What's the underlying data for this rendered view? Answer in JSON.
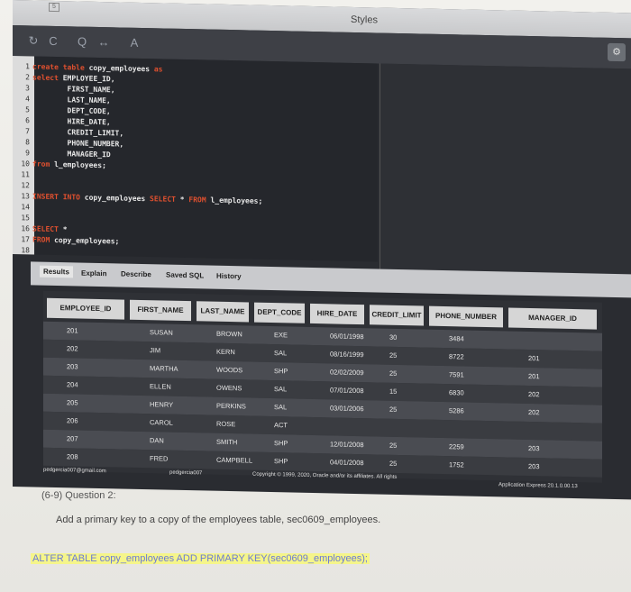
{
  "window": {
    "title": "Styles",
    "corner_glyph": "5"
  },
  "toolbar": {
    "icons": [
      "undo-icon",
      "redo-icon",
      "search-icon",
      "swap-icon",
      "text-icon"
    ],
    "glyphs": [
      "↻",
      "C",
      "Q",
      "↔",
      "A"
    ]
  },
  "editor": {
    "lines": [
      {
        "n": "1",
        "parts": [
          {
            "t": "create table",
            "k": true
          },
          {
            "t": " copy_employees ",
            "k": false
          },
          {
            "t": "as",
            "k": true
          }
        ]
      },
      {
        "n": "2",
        "parts": [
          {
            "t": "select",
            "k": true
          },
          {
            "t": " EMPLOYEE_ID,",
            "k": false
          }
        ]
      },
      {
        "n": "3",
        "parts": [
          {
            "t": "        FIRST_NAME,",
            "k": false
          }
        ]
      },
      {
        "n": "4",
        "parts": [
          {
            "t": "        LAST_NAME,",
            "k": false
          }
        ]
      },
      {
        "n": "5",
        "parts": [
          {
            "t": "        DEPT_CODE,",
            "k": false
          }
        ]
      },
      {
        "n": "6",
        "parts": [
          {
            "t": "        HIRE_DATE,",
            "k": false
          }
        ]
      },
      {
        "n": "7",
        "parts": [
          {
            "t": "        CREDIT_LIMIT,",
            "k": false
          }
        ]
      },
      {
        "n": "8",
        "parts": [
          {
            "t": "        PHONE_NUMBER,",
            "k": false
          }
        ]
      },
      {
        "n": "9",
        "parts": [
          {
            "t": "        MANAGER_ID",
            "k": false
          }
        ]
      },
      {
        "n": "10",
        "parts": [
          {
            "t": "from",
            "k": true
          },
          {
            "t": " l_employees;",
            "k": false
          }
        ]
      },
      {
        "n": "11",
        "parts": []
      },
      {
        "n": "12",
        "parts": []
      },
      {
        "n": "13",
        "parts": [
          {
            "t": "INSERT INTO",
            "k": true
          },
          {
            "t": " copy_employees ",
            "k": false
          },
          {
            "t": "SELECT",
            "k": true
          },
          {
            "t": " * ",
            "k": false
          },
          {
            "t": "FROM",
            "k": true
          },
          {
            "t": " l_employees;",
            "k": false
          }
        ]
      },
      {
        "n": "14",
        "parts": []
      },
      {
        "n": "15",
        "parts": []
      },
      {
        "n": "16",
        "parts": [
          {
            "t": "SELECT",
            "k": true
          },
          {
            "t": " *",
            "k": false
          }
        ]
      },
      {
        "n": "17",
        "parts": [
          {
            "t": "FROM",
            "k": true
          },
          {
            "t": " copy_employees;",
            "k": false
          }
        ]
      },
      {
        "n": "18",
        "parts": []
      }
    ]
  },
  "tabs": [
    "Results",
    "Explain",
    "Describe",
    "Saved SQL",
    "History"
  ],
  "results": {
    "columns": [
      "EMPLOYEE_ID",
      "FIRST_NAME",
      "LAST_NAME",
      "DEPT_CODE",
      "HIRE_DATE",
      "CREDIT_LIMIT",
      "PHONE_NUMBER",
      "MANAGER_ID"
    ],
    "rows": [
      [
        "201",
        "SUSAN",
        "BROWN",
        "EXE",
        "06/01/1998",
        "30",
        "3484",
        ""
      ],
      [
        "202",
        "JIM",
        "KERN",
        "SAL",
        "08/16/1999",
        "25",
        "8722",
        "201"
      ],
      [
        "203",
        "MARTHA",
        "WOODS",
        "SHP",
        "02/02/2009",
        "25",
        "7591",
        "201"
      ],
      [
        "204",
        "ELLEN",
        "OWENS",
        "SAL",
        "07/01/2008",
        "15",
        "6830",
        "202"
      ],
      [
        "205",
        "HENRY",
        "PERKINS",
        "SAL",
        "03/01/2006",
        "25",
        "5286",
        "202"
      ],
      [
        "206",
        "CAROL",
        "ROSE",
        "ACT",
        "",
        "",
        "",
        ""
      ],
      [
        "207",
        "DAN",
        "SMITH",
        "SHP",
        "12/01/2008",
        "25",
        "2259",
        "203"
      ],
      [
        "208",
        "FRED",
        "CAMPBELL",
        "SHP",
        "04/01/2008",
        "25",
        "1752",
        "203"
      ]
    ]
  },
  "footer": {
    "email": "pedgercia007@gmail.com",
    "user": "pedgercia007",
    "copyright": "Copyright © 1999, 2020, Oracle and/or its affiliates. All rights",
    "version": "Application Express 20.1.0.00.13"
  },
  "question": {
    "number": "(6-9) Question 2:",
    "prompt": "Add a primary key to a copy of the employees table, sec0609_employees.",
    "answer": "ALTER TABLE copy_employees ADD PRIMARY KEY(sec0609_employees);"
  }
}
